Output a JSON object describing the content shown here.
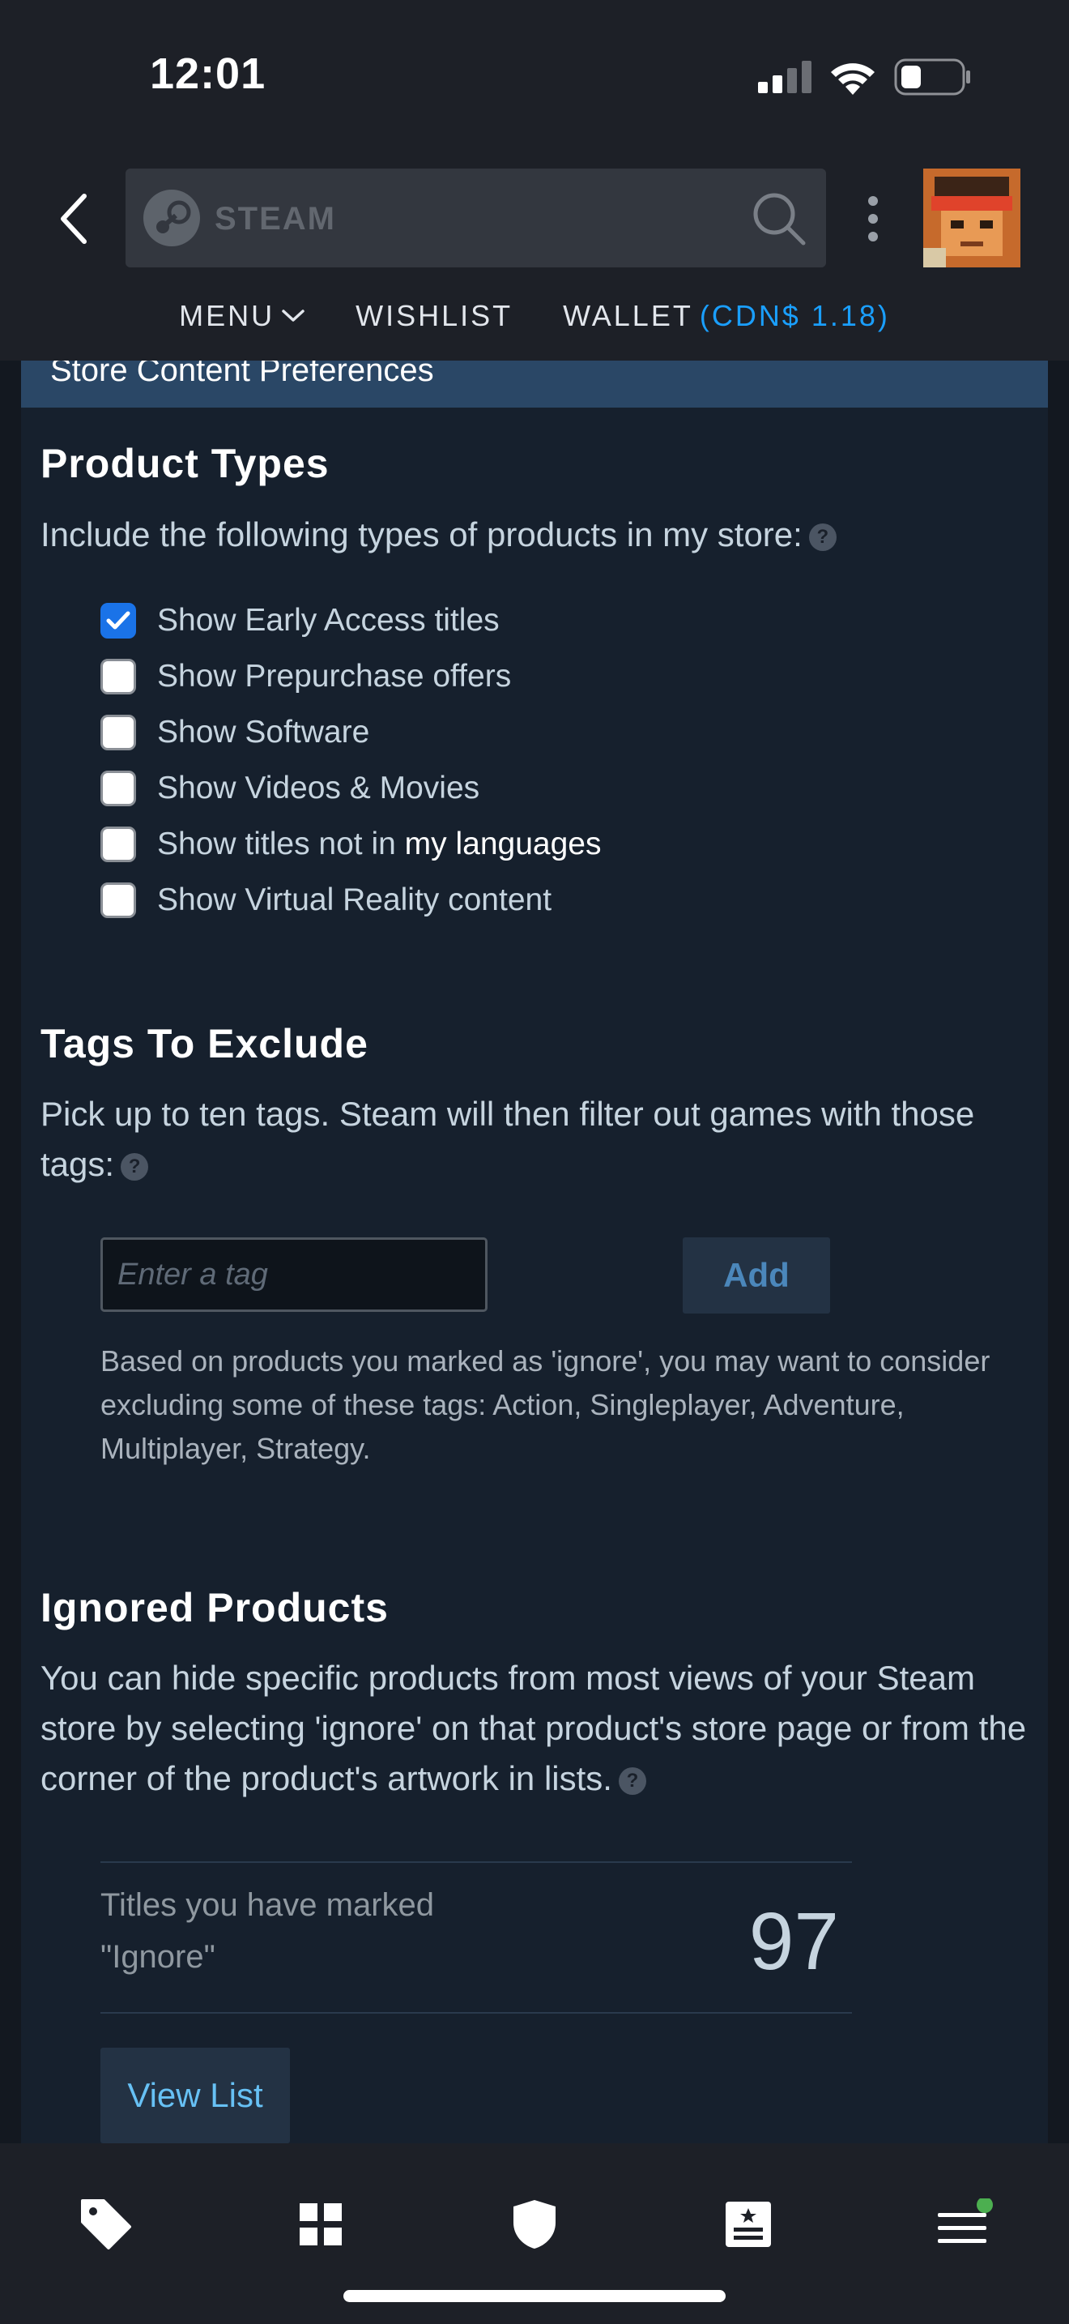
{
  "status": {
    "time": "12:01"
  },
  "header": {
    "search_brand": "STEAM",
    "nav": {
      "menu": "MENU",
      "wishlist": "WISHLIST",
      "wallet_label": "WALLET",
      "wallet_amount": "(CDN$ 1.18)"
    }
  },
  "page": {
    "section_title": "Store Content Preferences",
    "product_types": {
      "heading": "Product Types",
      "intro": "Include the following types of products in my store:",
      "options": [
        {
          "label": "Show Early Access titles",
          "checked": true
        },
        {
          "label": "Show Prepurchase offers",
          "checked": false
        },
        {
          "label": "Show Software",
          "checked": false
        },
        {
          "label": "Show Videos & Movies",
          "checked": false
        },
        {
          "label_prefix": "Show titles not in ",
          "label_link": "my languages",
          "checked": false
        },
        {
          "label": "Show Virtual Reality content",
          "checked": false
        }
      ]
    },
    "tags_exclude": {
      "heading": "Tags To Exclude",
      "intro": "Pick up to ten tags. Steam will then filter out games with those tags:",
      "input_placeholder": "Enter a tag",
      "input_value": "",
      "add_label": "Add",
      "suggestion": "Based on products you marked as 'ignore', you may want to consider excluding some of these tags: Action, Singleplayer, Adventure, Multiplayer, Strategy."
    },
    "ignored": {
      "heading": "Ignored Products",
      "intro": "You can hide specific products from most views of your Steam store by selecting 'ignore' on that product's store page or from the corner of the product's artwork in lists.",
      "count_label": "Titles you have marked \"Ignore\"",
      "count": "97",
      "view_list_label": "View List"
    }
  },
  "colors": {
    "accent_blue": "#1a9fff",
    "link_blue": "#67c1f5",
    "header_band": "#2a4766",
    "content_bg": "#16202d"
  },
  "tabbar": {
    "icons": [
      "tag-icon",
      "grid-icon",
      "shield-icon",
      "news-icon",
      "menu-icon"
    ],
    "notification_dot": true
  }
}
